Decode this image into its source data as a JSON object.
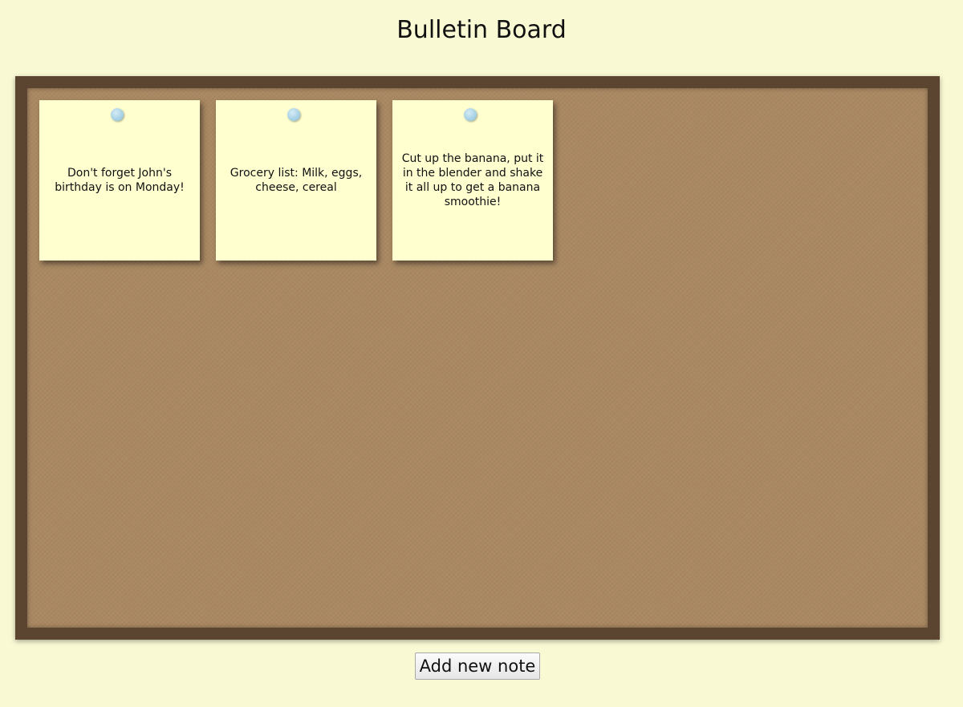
{
  "page": {
    "title": "Bulletin Board"
  },
  "board": {
    "notes": [
      {
        "text": "Don't forget John's birthday is on Monday!",
        "pin_color": "#a9d3e6"
      },
      {
        "text": "Grocery list: Milk, eggs, cheese, cereal",
        "pin_color": "#a9d3e6"
      },
      {
        "text": "Cut up the banana, put it in the blender and shake it all up to get a banana smoothie!",
        "pin_color": "#a9d3e6"
      }
    ]
  },
  "actions": {
    "add_note_label": "Add new note"
  },
  "colors": {
    "background": "#f9f9d4",
    "frame": "#5c4530",
    "cork": "#a98862",
    "note": "#ffffd0"
  }
}
